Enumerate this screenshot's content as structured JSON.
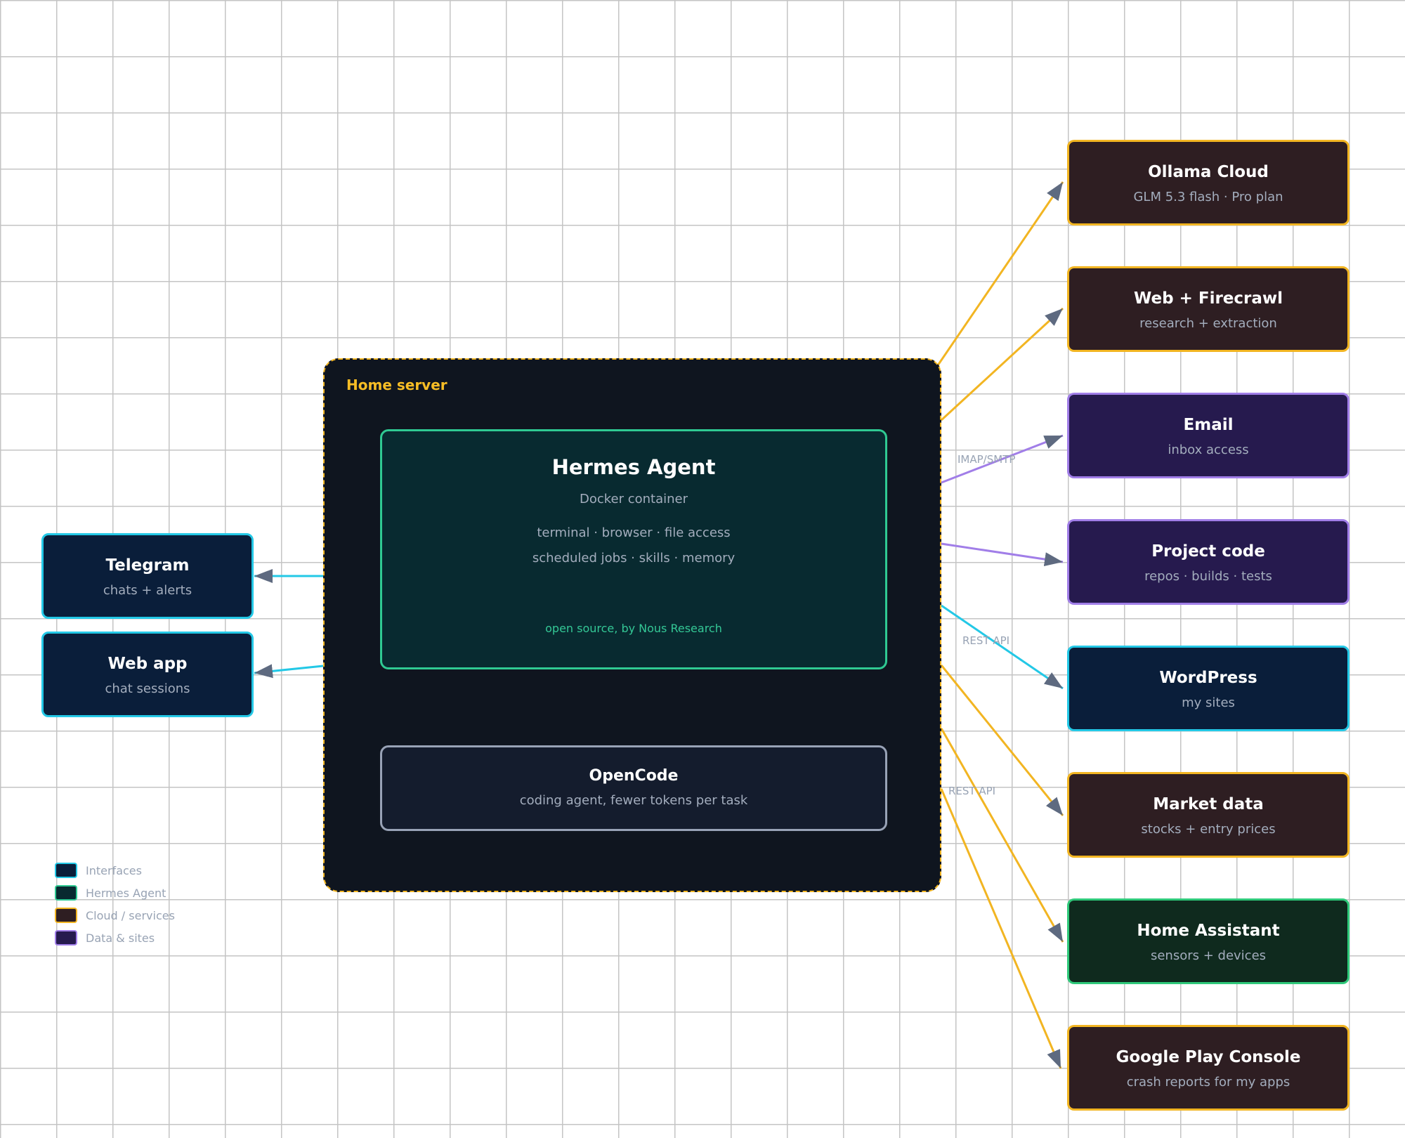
{
  "server": {
    "label": "Home server",
    "hermes": {
      "title": "Hermes Agent",
      "subtitle": "Docker container",
      "capabilities": [
        "terminal · browser · file access",
        "scheduled jobs · skills · memory"
      ],
      "footer": "open source, by Nous Research"
    },
    "opencode": {
      "title": "OpenCode",
      "subtitle": "coding agent, fewer tokens per task"
    }
  },
  "interfaces": [
    {
      "title": "Telegram",
      "subtitle": "chats + alerts"
    },
    {
      "title": "Web app",
      "subtitle": "chat sessions"
    }
  ],
  "services": [
    {
      "title": "Ollama Cloud",
      "subtitle": "GLM 5.3 flash · Pro plan"
    },
    {
      "title": "Web + Firecrawl",
      "subtitle": "research + extraction"
    },
    {
      "title": "Email",
      "subtitle": "inbox access"
    },
    {
      "title": "Project code",
      "subtitle": "repos · builds · tests"
    },
    {
      "title": "WordPress",
      "subtitle": "my sites"
    },
    {
      "title": "Market data",
      "subtitle": "stocks + entry prices"
    },
    {
      "title": "Home Assistant",
      "subtitle": "sensors + devices"
    },
    {
      "title": "Google Play Console",
      "subtitle": "crash reports for my apps"
    }
  ],
  "edge_labels": {
    "email": "IMAP/SMTP",
    "wordpress": "REST API",
    "home_assistant": "REST API"
  },
  "legend": {
    "items": [
      {
        "label": "Interfaces",
        "fill": "#0a1e3a",
        "border": "#23c8e6"
      },
      {
        "label": "Hermes Agent",
        "fill": "#082a30",
        "border": "#2fc992"
      },
      {
        "label": "Cloud / services",
        "fill": "#2e1e22",
        "border": "#f2b522"
      },
      {
        "label": "Data & sites",
        "fill": "#261a4e",
        "border": "#a17ee8"
      }
    ]
  },
  "colors": {
    "interface_fill": "#0a1e3a",
    "interface_border": "#23c8e6",
    "cloud_fill": "#2e1e22",
    "cloud_border": "#f2b522",
    "data_fill": "#261a4e",
    "data_border": "#a17ee8",
    "home_fill": "#0f2a1e",
    "home_border": "#2fc97a",
    "arrowhead": "#5e6a80"
  }
}
